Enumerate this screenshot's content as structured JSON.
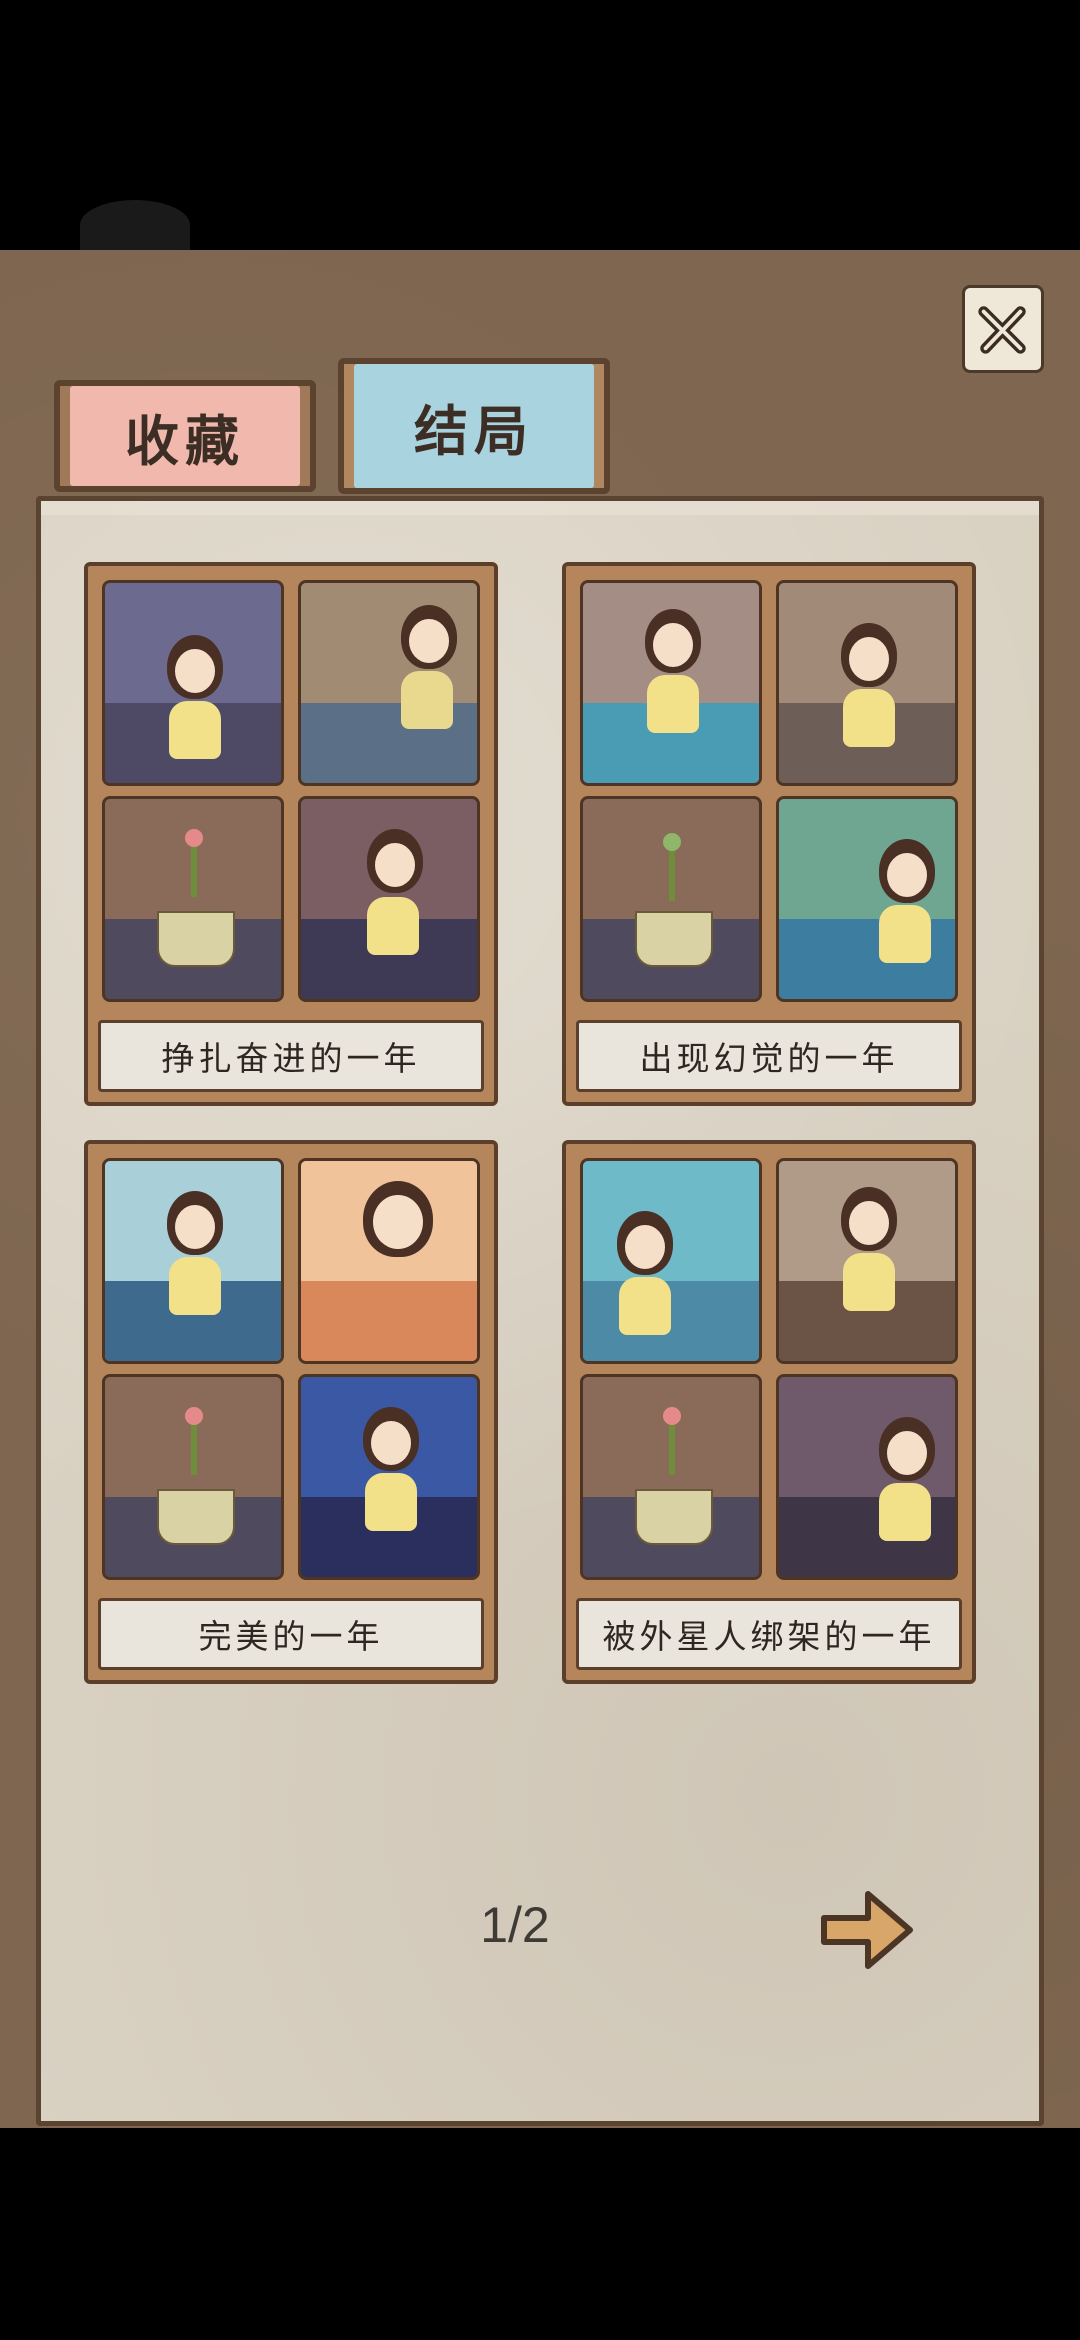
{
  "tabs": {
    "collect_label": "收藏",
    "ending_label": "结局",
    "active": "结局"
  },
  "endings": [
    {
      "caption": "挣扎奋进的一年"
    },
    {
      "caption": "出现幻觉的一年"
    },
    {
      "caption": "完美的一年"
    },
    {
      "caption": "被外星人绑架的一年"
    }
  ],
  "pagination": {
    "label": "1/2"
  },
  "icons": {
    "close": "close-icon",
    "next": "arrow-right-icon"
  },
  "colors": {
    "board": "#7e6650",
    "paper": "#d9d1c2",
    "tab_collect": "#f1b8ae",
    "tab_ending": "#a9d3de",
    "card_frame": "#b5855c"
  }
}
